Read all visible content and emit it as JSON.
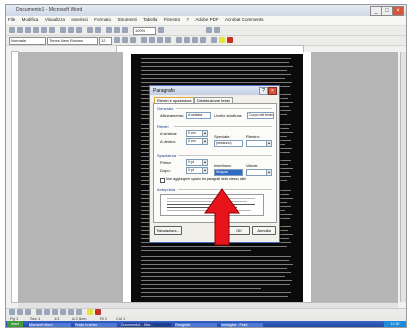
{
  "window": {
    "title": "Documento1 - Microsoft Word"
  },
  "menu": {
    "items": [
      "File",
      "Modifica",
      "Visualizza",
      "Inserisci",
      "Formato",
      "Strumenti",
      "Tabella",
      "Finestra",
      "?",
      "Adobe PDF",
      "Acrobat Comments"
    ]
  },
  "toolbar": {
    "style_value": "Normale",
    "font_value": "Times New Roman",
    "size_value": "12",
    "zoom_value": "100%"
  },
  "dialog": {
    "title": "Paragrafo",
    "help_glyph": "?",
    "close_glyph": "×",
    "tabs": [
      "Rientri e spaziatura",
      "Distribuzione testo"
    ],
    "general": {
      "group": "Generale",
      "alignment_label": "Allineamento:",
      "alignment_value": "A sinistra",
      "outline_label": "Livello struttura:",
      "outline_value": "Corpo del testo"
    },
    "indent": {
      "group": "Rientri",
      "left_label": "A sinistra:",
      "left_value": "0 cm",
      "right_label": "A destra:",
      "right_value": "0 cm",
      "special_label": "Speciale:",
      "special_value": "(nessuno)",
      "by_label": "Rientro:"
    },
    "spacing": {
      "group": "Spaziatura",
      "before_label": "Prima:",
      "before_value": "0 pt",
      "after_label": "Dopo:",
      "after_value": "0 pt",
      "line_label": "Interlinea:",
      "line_value": "Singola",
      "at_label": "Valore:",
      "no_space_label": "Non aggiungere spazio tra paragrafi dello stesso stile"
    },
    "preview_group": "Anteprima",
    "buttons": {
      "tabs": "Tabulazioni...",
      "ok": "OK",
      "cancel": "Annulla"
    }
  },
  "status": {
    "page": "Pg 1",
    "section": "Sez 1",
    "pages": "1/1",
    "position": "A 2,5cm",
    "line": "Ri 1",
    "column": "Col 1"
  },
  "taskbar": {
    "start": "start",
    "items": [
      "Microsoft Word",
      "Posta in arrivo",
      "Documento1 - Micr...",
      "Paragrafo",
      "Immagine - Paint"
    ],
    "clock": "12.30"
  },
  "annotation": {
    "arrow_color": "#e8141b"
  },
  "colors": {
    "accent": "#316ac5",
    "titlebar": "#c3cfe3",
    "taskbar": "#2549a4"
  }
}
